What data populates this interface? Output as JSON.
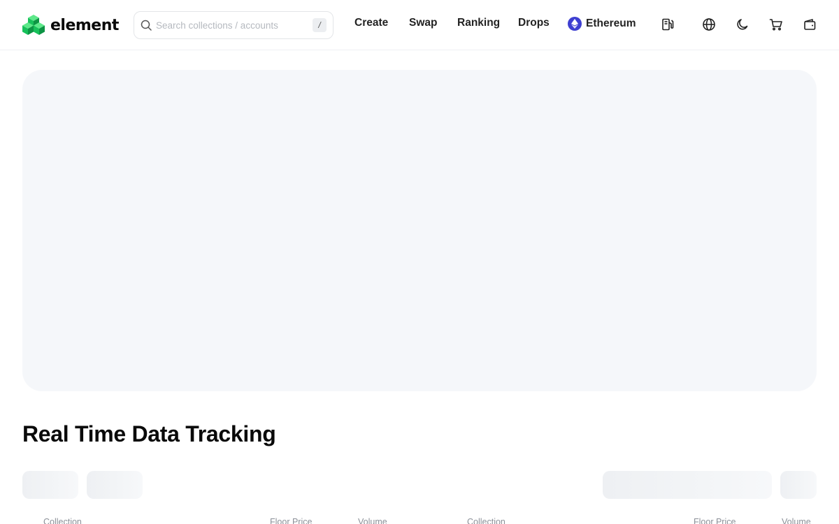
{
  "brand": {
    "name": "element"
  },
  "search": {
    "placeholder": "Search collections / accounts",
    "shortcut": "/"
  },
  "nav": {
    "items": [
      {
        "label": "Create"
      },
      {
        "label": "Swap"
      },
      {
        "label": "Ranking"
      },
      {
        "label": "Drops"
      }
    ],
    "chain": {
      "label": "Ethereum",
      "color": "#3e3fd1"
    }
  },
  "icons": [
    "gas-pump-icon",
    "globe-icon",
    "moon-icon",
    "cart-icon",
    "wallet-icon"
  ],
  "section": {
    "title": "Real Time Data Tracking"
  },
  "table": {
    "columns_left": [
      "Collection",
      "Floor Price",
      "Volume"
    ],
    "columns_right": [
      "Collection",
      "Floor Price",
      "Volume"
    ]
  },
  "colors": {
    "accent": "#3e3fd1",
    "logo_green": "#17c15a",
    "hero_bg": "#f5f7fa"
  }
}
